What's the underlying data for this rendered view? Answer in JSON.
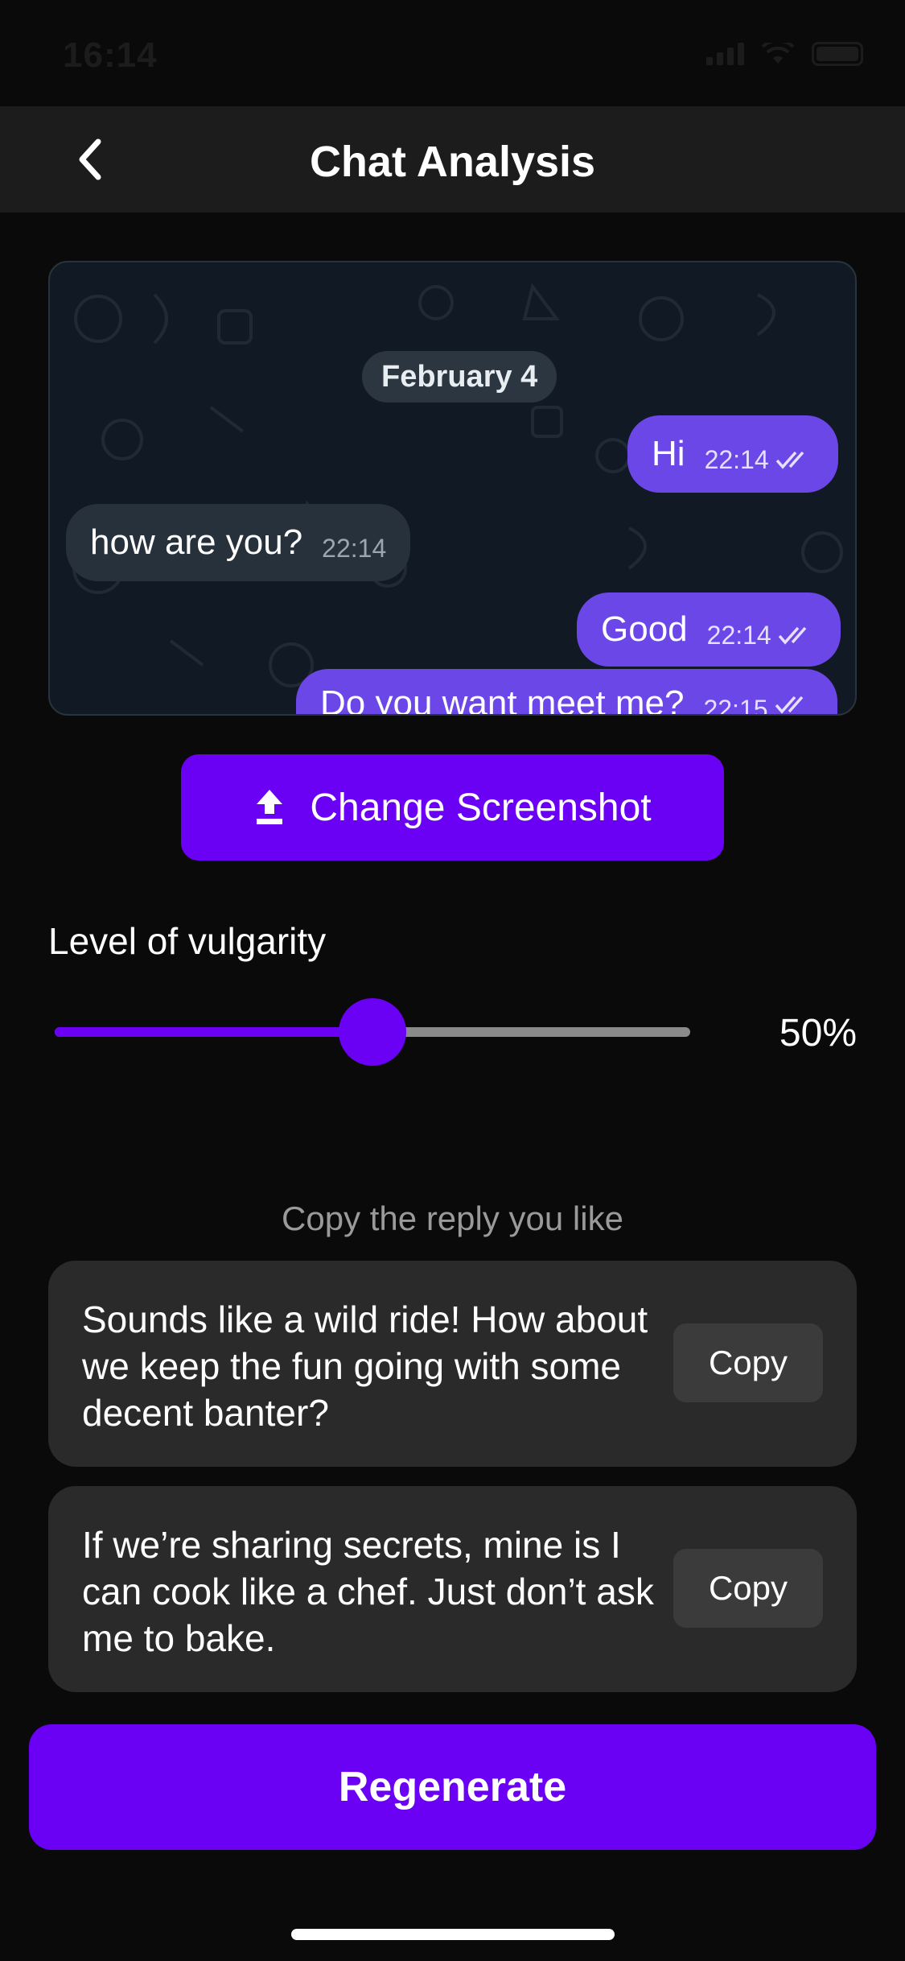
{
  "status_bar": {
    "time": "16:14"
  },
  "header": {
    "title": "Chat Analysis"
  },
  "preview": {
    "date": "February 4",
    "messages": [
      {
        "text": "Hi",
        "time": "22:14",
        "direction": "out"
      },
      {
        "text": "how are you?",
        "time": "22:14",
        "direction": "in"
      },
      {
        "text": "Good",
        "time": "22:14",
        "direction": "out"
      },
      {
        "text": "Do you want meet me?",
        "time": "22:15",
        "direction": "out"
      }
    ]
  },
  "change_screenshot": {
    "label": "Change Screenshot",
    "icon": "upload-icon"
  },
  "vulgarity": {
    "label": "Level of vulgarity",
    "value": 50,
    "value_label": "50%"
  },
  "replies": {
    "hint": "Copy the reply you like",
    "items": [
      {
        "text": "Sounds like a wild ride! How about we keep the fun going with some decent banter?",
        "copy_label": "Copy"
      },
      {
        "text": "If we’re sharing secrets, mine is I can cook like a chef. Just don’t ask me to bake.",
        "copy_label": "Copy"
      }
    ]
  },
  "regenerate": {
    "label": "Regenerate"
  },
  "colors": {
    "accent": "#6a00f4",
    "card": "#2a2a2a",
    "background": "#0a0a0a",
    "outgoing_bubble": "#6c47e8",
    "incoming_bubble": "#26313b"
  }
}
